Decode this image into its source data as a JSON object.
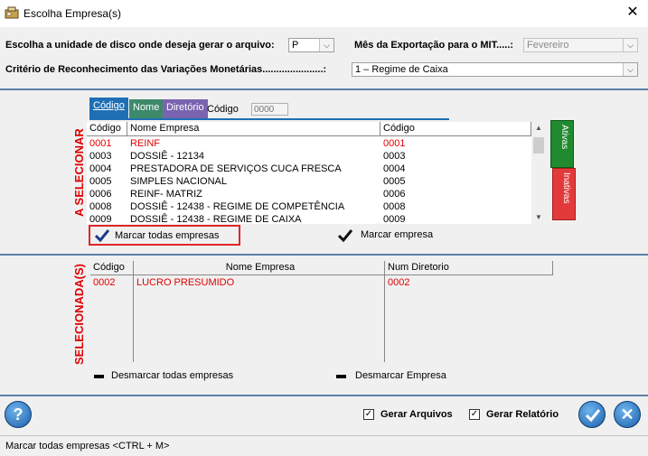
{
  "window": {
    "title": "Escolha Empresa(s)"
  },
  "options": {
    "disk_label": "Escolha a unidade de disco onde deseja gerar o arquivo:",
    "disk_value": "P",
    "month_label": "Mês da Exportação para o MIT.....:",
    "month_value": "Fevereiro",
    "criterion_label": "Critério de Reconhecimento das Variações Monetárias......................:",
    "criterion_value": "1 – Regime de Caixa"
  },
  "tabs": [
    {
      "label": "Código",
      "color": "#1f6fb5"
    },
    {
      "label": "Nome",
      "color": "#3d8a6a"
    },
    {
      "label": "Diretório",
      "color": "#7a63b0"
    }
  ],
  "search": {
    "label": "Código",
    "placeholder": "0000"
  },
  "to_select": {
    "side_label": "A SELECIONAR",
    "columns": [
      "Código",
      "Nome Empresa",
      "Código"
    ],
    "rows": [
      {
        "code": "0001",
        "name": "REINF",
        "code2": "0001",
        "highlight": true
      },
      {
        "code": "0003",
        "name": "DOSSIÊ - 12134",
        "code2": "0003",
        "highlight": false
      },
      {
        "code": "0004",
        "name": "PRESTADORA DE SERVIÇOS CUCA FRESCA",
        "code2": "0004",
        "highlight": false
      },
      {
        "code": "0005",
        "name": "SIMPLES NACIONAL",
        "code2": "0005",
        "highlight": false
      },
      {
        "code": "0006",
        "name": "REINF-  MATRIZ",
        "code2": "0006",
        "highlight": false
      },
      {
        "code": "0008",
        "name": "DOSSIÊ - 12438 - REGIME DE COMPETÊNCIA",
        "code2": "0008",
        "highlight": false
      },
      {
        "code": "0009",
        "name": "DOSSIÊ - 12438 - REGIME DE CAIXA",
        "code2": "0009",
        "highlight": false
      }
    ],
    "side_tabs": [
      {
        "label": "Ativas",
        "color": "#1f8a2e"
      },
      {
        "label": "Inativas",
        "color": "#e23a3a"
      }
    ],
    "mark_all_label": "Marcar todas empresas",
    "mark_one_label": "Marcar empresa"
  },
  "selected": {
    "side_label": "SELECIONADA(S)",
    "columns": [
      "Código",
      "Nome Empresa",
      "Num Diretorio"
    ],
    "rows": [
      {
        "code": "0002",
        "name": "LUCRO PRESUMIDO",
        "code2": "0002"
      }
    ],
    "unmark_all_label": "Desmarcar todas empresas",
    "unmark_one_label": "Desmarcar Empresa"
  },
  "footer": {
    "gen_files_label": "Gerar Arquivos",
    "gen_files_checked": true,
    "gen_report_label": "Gerar Relatório",
    "gen_report_checked": true
  },
  "status": {
    "text": "Marcar todas empresas  <CTRL + M>"
  }
}
